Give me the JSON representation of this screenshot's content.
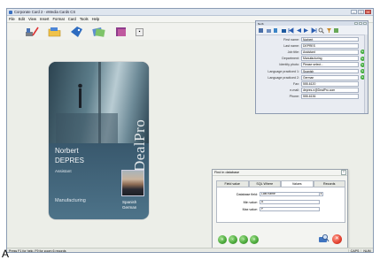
{
  "window": {
    "title": "Corporate Card 2 - eMedia Cards CS"
  },
  "menu": [
    "File",
    "Edit",
    "View",
    "Insert",
    "Format",
    "Card",
    "Tools",
    "Help"
  ],
  "toolbar": {
    "icons": [
      "brush-pen-icon",
      "folder-icon",
      "tag-icon",
      "cards-icon",
      "sheets-icon",
      "document-icon"
    ]
  },
  "card": {
    "company_text": "DealPro",
    "first_name": "Norbert",
    "last_name": "DEPRES",
    "job_title": "Assistant",
    "department": "Manufacturing",
    "language1": "Spanish",
    "language2": "German"
  },
  "panel": {
    "title": "Norb",
    "fields": [
      {
        "label": "First name:",
        "value": "Norbert"
      },
      {
        "label": "Last name:",
        "value": "DEPRES"
      },
      {
        "label": "Job title:",
        "value": "Assistant"
      },
      {
        "label": "Department:",
        "value": "Manufacturing"
      },
      {
        "label": "Identity photo:",
        "value": "Please select..."
      },
      {
        "label": "Language practiced 1:",
        "value": "Spanish"
      },
      {
        "label": "Language practiced 2:",
        "value": "German"
      },
      {
        "label": "Fax:",
        "value": "555-6120"
      },
      {
        "label": "e-mail:",
        "value": "depres.n@DealPro.com"
      },
      {
        "label": "Phone:",
        "value": "555-6136"
      }
    ]
  },
  "find_dialog": {
    "title": "Find in database",
    "tabs": [
      "Field value",
      "SQL Where",
      "Values",
      "Records"
    ],
    "active_tab": "Values",
    "database_field_label": "Database field:",
    "database_field_value": "Last name",
    "min_label": "Min value:",
    "min_value": "A",
    "max_label": "Max value:",
    "max_value": "P"
  },
  "statusbar": {
    "text": "Press F1 for help, F9 for zoom  6 records",
    "caps": "CAPS",
    "num": "NUM"
  },
  "figure_label": "A"
}
